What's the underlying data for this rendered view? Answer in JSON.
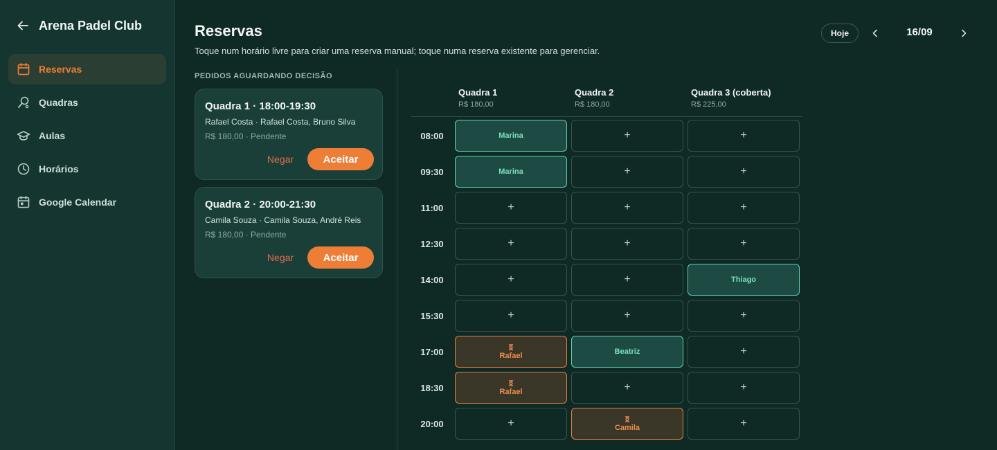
{
  "app": {
    "title": "Arena Padel Club"
  },
  "sidebar": {
    "items": [
      {
        "label": "Reservas",
        "icon": "calendar-icon",
        "active": true
      },
      {
        "label": "Quadras",
        "icon": "court-icon",
        "active": false
      },
      {
        "label": "Aulas",
        "icon": "graduation-cap-icon",
        "active": false
      },
      {
        "label": "Horários",
        "icon": "clock-icon",
        "active": false
      },
      {
        "label": "Google Calendar",
        "icon": "calendar-sync-icon",
        "active": false
      }
    ]
  },
  "header": {
    "title": "Reservas",
    "subtitle": "Toque num horário livre para criar uma reserva manual; toque numa reserva existente para gerenciar.",
    "today_label": "Hoje",
    "date": "16/09"
  },
  "pending": {
    "title": "PEDIDOS AGUARDANDO DECISÃO",
    "cards": [
      {
        "title": "Quadra 1 · 18:00-19:30",
        "people": "Rafael Costa · Rafael Costa, Bruno Silva",
        "meta": "R$ 180,00 · Pendente",
        "deny_label": "Negar",
        "accept_label": "Aceitar"
      },
      {
        "title": "Quadra 2 · 20:00-21:30",
        "people": "Camila Souza · Camila Souza, André Reis",
        "meta": "R$ 180,00 · Pendente",
        "deny_label": "Negar",
        "accept_label": "Aceitar"
      }
    ]
  },
  "schedule": {
    "courts": [
      {
        "name": "Quadra 1",
        "price": "R$ 180,00"
      },
      {
        "name": "Quadra 2",
        "price": "R$ 180,00"
      },
      {
        "name": "Quadra 3 (coberta)",
        "price": "R$ 225,00"
      }
    ],
    "times": [
      "08:00",
      "09:30",
      "11:00",
      "12:30",
      "14:00",
      "15:30",
      "17:00",
      "18:30",
      "20:00"
    ],
    "empty_symbol": "+",
    "slots": [
      [
        {
          "status": "booked",
          "name": "Marina"
        },
        {
          "status": "empty"
        },
        {
          "status": "empty"
        }
      ],
      [
        {
          "status": "booked",
          "name": "Marina"
        },
        {
          "status": "empty"
        },
        {
          "status": "empty"
        }
      ],
      [
        {
          "status": "empty"
        },
        {
          "status": "empty"
        },
        {
          "status": "empty"
        }
      ],
      [
        {
          "status": "empty"
        },
        {
          "status": "empty"
        },
        {
          "status": "empty"
        }
      ],
      [
        {
          "status": "empty"
        },
        {
          "status": "empty"
        },
        {
          "status": "booked",
          "name": "Thiago"
        }
      ],
      [
        {
          "status": "empty"
        },
        {
          "status": "empty"
        },
        {
          "status": "empty"
        }
      ],
      [
        {
          "status": "pending",
          "name": "Rafael"
        },
        {
          "status": "booked",
          "name": "Beatriz"
        },
        {
          "status": "empty"
        }
      ],
      [
        {
          "status": "pending",
          "name": "Rafael"
        },
        {
          "status": "empty"
        },
        {
          "status": "empty"
        }
      ],
      [
        {
          "status": "empty"
        },
        {
          "status": "pending",
          "name": "Camila"
        },
        {
          "status": "empty"
        }
      ]
    ]
  },
  "colors": {
    "accent": "#ee7d35",
    "booked_border": "#5fd3b0",
    "pending_border": "#e3803f",
    "deny": "#e26a4e"
  }
}
